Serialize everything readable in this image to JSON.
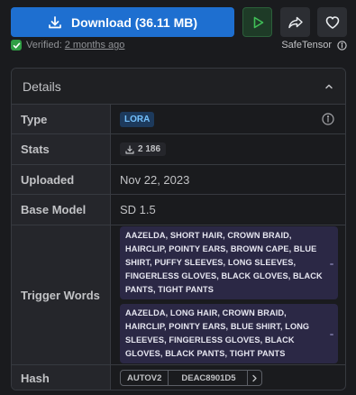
{
  "actions": {
    "download_label": "Download (36.11 MB)",
    "play_icon": "play-icon",
    "share_icon": "share-icon",
    "like_icon": "heart-icon"
  },
  "verified": {
    "prefix": "Verified:",
    "time": "2 months ago",
    "format": "SafeTensor"
  },
  "details": {
    "title": "Details",
    "rows": {
      "type": {
        "label": "Type",
        "value": "LORA"
      },
      "stats": {
        "label": "Stats",
        "downloads": "2 186"
      },
      "uploaded": {
        "label": "Uploaded",
        "value": "Nov 22, 2023"
      },
      "base_model": {
        "label": "Base Model",
        "value": "SD 1.5"
      },
      "trigger_words": {
        "label": "Trigger Words",
        "items": [
          "AAZELDA, SHORT HAIR, CROWN BRAID, HAIRCLIP, POINTY EARS, BROWN CAPE, BLUE SHIRT, PUFFY SLEEVES, LONG SLEEVES, FINGERLESS GLOVES, BLACK GLOVES, BLACK PANTS, TIGHT PANTS",
          "AAZELDA, LONG HAIR, CROWN BRAID, HAIRCLIP, POINTY EARS, BLUE SHIRT, LONG SLEEVES, FINGERLESS GLOVES, BLACK GLOVES, BLACK PANTS, TIGHT PANTS"
        ]
      },
      "hash": {
        "label": "Hash",
        "type": "AUTOV2",
        "value": "DEAC8901D5"
      }
    }
  },
  "colors": {
    "accent": "#1e6fd0",
    "verified": "#2f9e44",
    "trigger_bg": "#2b2845",
    "lora_badge": "#74c0fc"
  }
}
